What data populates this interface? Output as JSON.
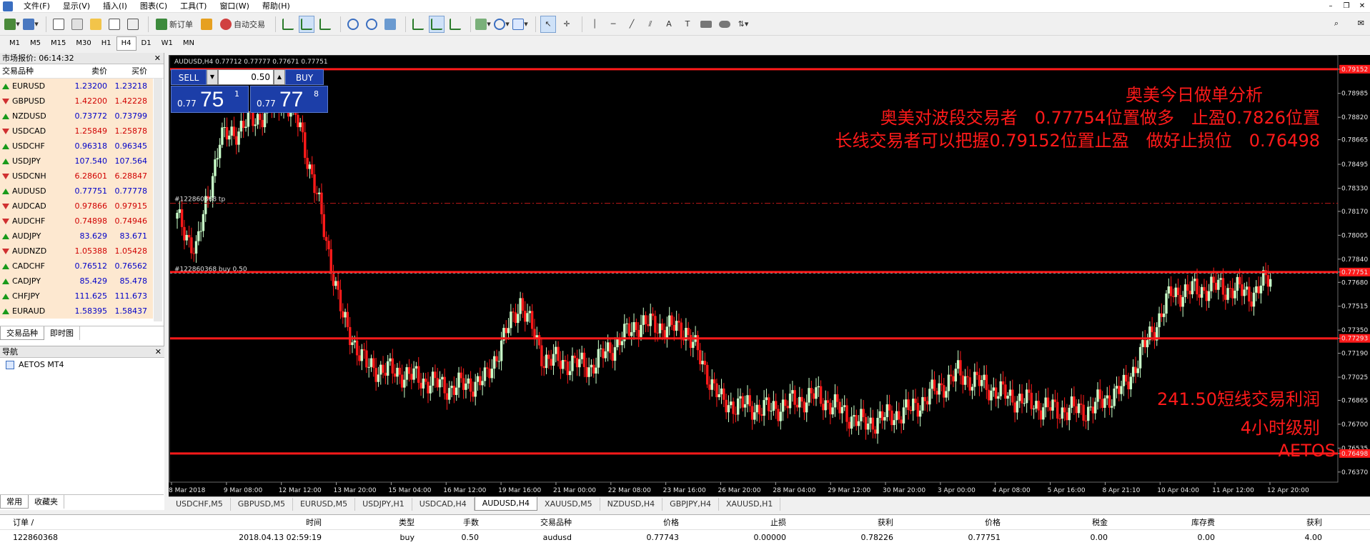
{
  "menu": {
    "items": [
      "文件(F)",
      "显示(V)",
      "插入(I)",
      "图表(C)",
      "工具(T)",
      "窗口(W)",
      "帮助(H)"
    ]
  },
  "toolbar": {
    "new_order": "新订单",
    "auto_trading": "自动交易"
  },
  "timeframes": [
    "M1",
    "M5",
    "M15",
    "M30",
    "H1",
    "H4",
    "D1",
    "W1",
    "MN"
  ],
  "active_timeframe": "H4",
  "market_watch": {
    "title": "市场报价: 06:14:32",
    "col_symbol": "交易品种",
    "col_bid": "卖价",
    "col_ask": "买价",
    "rows": [
      {
        "symbol": "EURUSD",
        "bid": "1.23200",
        "ask": "1.23218",
        "dir": "up"
      },
      {
        "symbol": "GBPUSD",
        "bid": "1.42200",
        "ask": "1.42228",
        "dir": "down"
      },
      {
        "symbol": "NZDUSD",
        "bid": "0.73772",
        "ask": "0.73799",
        "dir": "up"
      },
      {
        "symbol": "USDCAD",
        "bid": "1.25849",
        "ask": "1.25878",
        "dir": "down"
      },
      {
        "symbol": "USDCHF",
        "bid": "0.96318",
        "ask": "0.96345",
        "dir": "up"
      },
      {
        "symbol": "USDJPY",
        "bid": "107.540",
        "ask": "107.564",
        "dir": "up"
      },
      {
        "symbol": "USDCNH",
        "bid": "6.28601",
        "ask": "6.28847",
        "dir": "down"
      },
      {
        "symbol": "AUDUSD",
        "bid": "0.77751",
        "ask": "0.77778",
        "dir": "up"
      },
      {
        "symbol": "AUDCAD",
        "bid": "0.97866",
        "ask": "0.97915",
        "dir": "down"
      },
      {
        "symbol": "AUDCHF",
        "bid": "0.74898",
        "ask": "0.74946",
        "dir": "down"
      },
      {
        "symbol": "AUDJPY",
        "bid": "83.629",
        "ask": "83.671",
        "dir": "up"
      },
      {
        "symbol": "AUDNZD",
        "bid": "1.05388",
        "ask": "1.05428",
        "dir": "down"
      },
      {
        "symbol": "CADCHF",
        "bid": "0.76512",
        "ask": "0.76562",
        "dir": "up"
      },
      {
        "symbol": "CADJPY",
        "bid": "85.429",
        "ask": "85.478",
        "dir": "up"
      },
      {
        "symbol": "CHFJPY",
        "bid": "111.625",
        "ask": "111.673",
        "dir": "up"
      },
      {
        "symbol": "EURAUD",
        "bid": "1.58395",
        "ask": "1.58437",
        "dir": "up"
      }
    ],
    "tabs": [
      "交易品种",
      "即时图"
    ]
  },
  "navigator": {
    "title": "导航",
    "item": "AETOS MT4",
    "tabs": [
      "常用",
      "收藏夹"
    ]
  },
  "chart": {
    "header": "AUDUSD,H4  0.77712 0.77777 0.77671 0.77751",
    "trade_panel": {
      "sell": "SELL",
      "buy": "BUY",
      "lots": "0.50",
      "sell_small": "0.77",
      "sell_big": "75",
      "sell_sup": "1",
      "buy_small": "0.77",
      "buy_big": "77",
      "buy_sup": "8"
    },
    "order_tp_label": "#122860368 tp",
    "order_buy_label": "#122860368 buy 0.50",
    "overlay": {
      "line1": "奥美今日做单分析",
      "line2": "奥美对波段交易者　0.77754位置做多　止盈0.7826位置",
      "line3": "长线交易者可以把握0.79152位置止盈　做好止损位　0.76498",
      "line4": "241.50短线交易利润",
      "line5": "4小时级别",
      "line6": "AETOS"
    },
    "price_axis": [
      "0.79152",
      "0.78985",
      "0.78820",
      "0.78665",
      "0.78495",
      "0.78330",
      "0.78170",
      "0.78005",
      "0.77840",
      "0.77751",
      "0.77680",
      "0.77515",
      "0.77350",
      "0.77293",
      "0.77190",
      "0.77025",
      "0.76865",
      "0.76700",
      "0.76535",
      "0.76498",
      "0.76370"
    ],
    "time_axis": [
      "8 Mar 2018",
      "9 Mar 08:00",
      "12 Mar 12:00",
      "13 Mar 20:00",
      "15 Mar 04:00",
      "16 Mar 12:00",
      "19 Mar 16:00",
      "21 Mar 00:00",
      "22 Mar 08:00",
      "23 Mar 16:00",
      "26 Mar 20:00",
      "28 Mar 04:00",
      "29 Mar 12:00",
      "30 Mar 20:00",
      "3 Apr 00:00",
      "4 Apr 08:00",
      "5 Apr 16:00",
      "8 Apr 21:10",
      "10 Apr 04:00",
      "11 Apr 12:00",
      "12 Apr 20:00"
    ],
    "colors": {
      "bull": "#c8ffc8",
      "bear": "#ff1a1a",
      "line": "#ff1a1a",
      "tp": "#c01818"
    }
  },
  "symbol_tabs": [
    "USDCHF,M5",
    "GBPUSD,M5",
    "EURUSD,M5",
    "USDJPY,H1",
    "USDCAD,H4",
    "AUDUSD,H4",
    "XAUUSD,M5",
    "NZDUSD,H4",
    "GBPJPY,H4",
    "XAUUSD,H1"
  ],
  "active_symbol_tab": "AUDUSD,H4",
  "terminal": {
    "headers": [
      "订单 /",
      "时间",
      "类型",
      "手数",
      "交易品种",
      "价格",
      "止损",
      "获利",
      "价格",
      "税金",
      "库存费",
      "获利"
    ],
    "row": [
      "122860368",
      "2018.04.13 02:59:19",
      "buy",
      "0.50",
      "audusd",
      "0.77743",
      "0.00000",
      "0.78226",
      "0.77751",
      "0.00",
      "0.00",
      "4.00"
    ]
  }
}
